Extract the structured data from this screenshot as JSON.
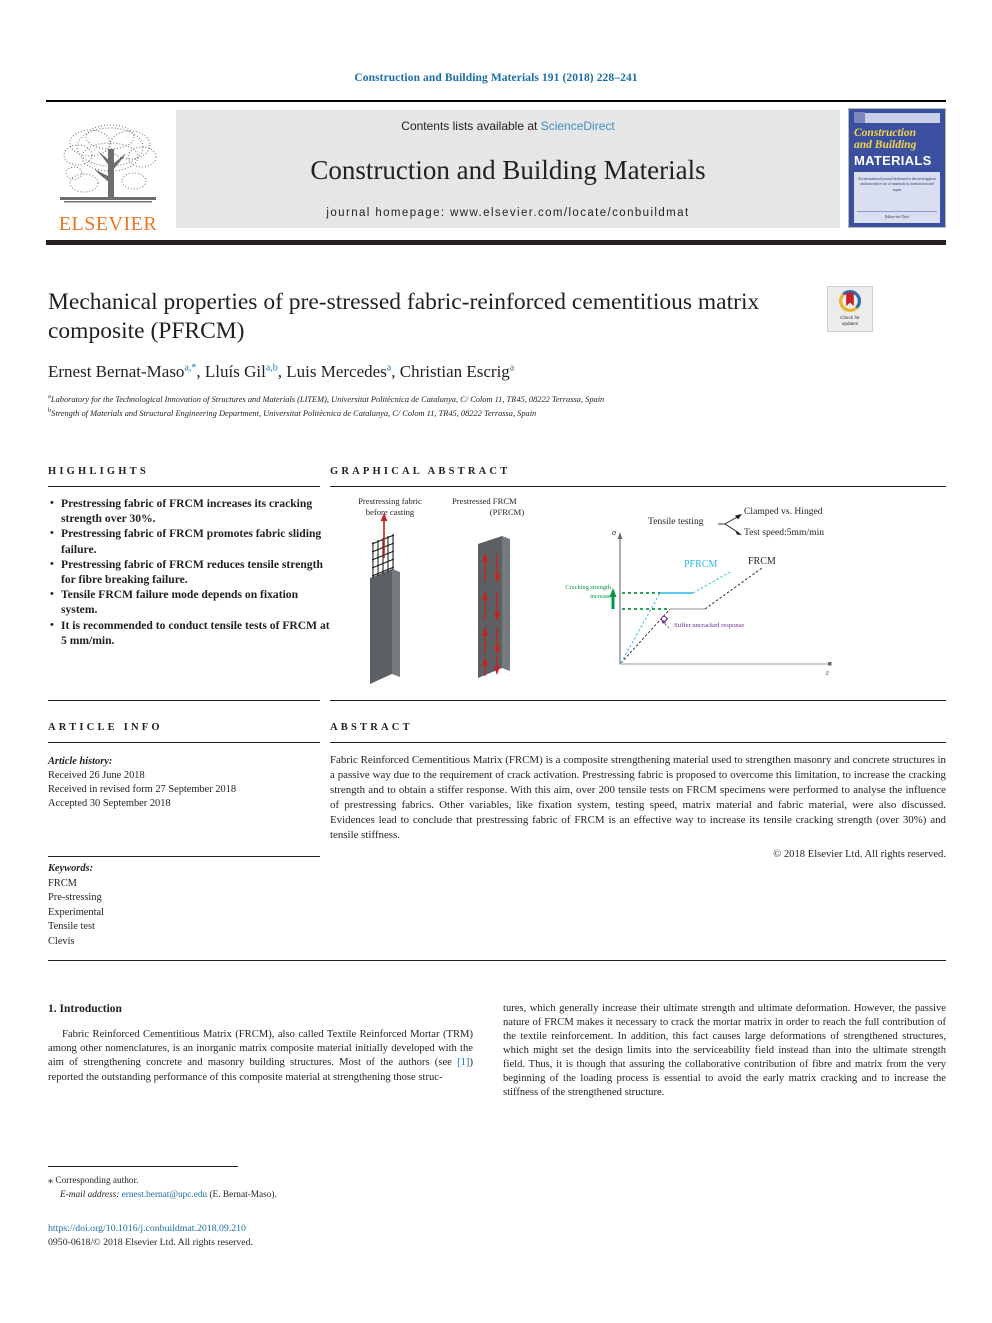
{
  "running_head": "Construction and Building Materials 191 (2018) 228–241",
  "masthead": {
    "publisher_name": "ELSEVIER",
    "contents_prefix": "Contents lists available at ",
    "sciencedirect": "ScienceDirect",
    "journal_name": "Construction and Building Materials",
    "homepage": "journal homepage: www.elsevier.com/locate/conbuildmat",
    "cover": {
      "line1": "Construction",
      "line2": "and Building",
      "line3": "MATERIALS",
      "blurb": "An international journal dedicated to the investigation and innovative use of materials in construction and repair",
      "foot": "Editor-in-Chief"
    }
  },
  "article": {
    "title": "Mechanical properties of pre-stressed fabric-reinforced cementitious matrix composite (PFRCM)",
    "authors_html": "Ernest Bernat-Maso, Lluís Gil, Luis Mercedes, Christian Escrig",
    "authors": [
      {
        "name": "Ernest Bernat-Maso",
        "sup": "a,*"
      },
      {
        "name": "Lluís Gil",
        "sup": "a,b"
      },
      {
        "name": "Luis Mercedes",
        "sup": "a"
      },
      {
        "name": "Christian Escrig",
        "sup": "a"
      }
    ],
    "affiliations": [
      {
        "marker": "a",
        "text": "Laboratory for the Technological Innovation of Structures and Materials (LITEM), Universitat Politècnica de Catalunya, C/ Colom 11, TR45, 08222 Terrassa, Spain"
      },
      {
        "marker": "b",
        "text": "Strength of Materials and Structural Engineering Department, Universitat Politècnica de Catalunya, C/ Colom 11, TR45, 08222 Terrassa, Spain"
      }
    ],
    "crossmark": {
      "line1": "Check for",
      "line2": "updates"
    }
  },
  "highlights": {
    "heading": "HIGHLIGHTS",
    "items": [
      "Prestressing fabric of FRCM increases its cracking strength over 30%.",
      "Prestressing fabric of FRCM promotes fabric sliding failure.",
      "Prestressing fabric of FRCM reduces tensile strength for fibre breaking failure.",
      "Tensile FRCM failure mode depends on fixation system.",
      "It is recommended to conduct tensile tests of FRCM at 5 mm/min."
    ]
  },
  "graphical_abstract": {
    "heading": "GRAPHICAL ABSTRACT",
    "labels": {
      "panel1_l1": "Prestressing fabric",
      "panel1_l2": "before casting",
      "panel2_l1": "Prestressed FRCM",
      "panel2_l2": "(PFRCM)",
      "tensile_testing": "Tensile testing",
      "clamped_hinged": "Clamped vs. Hinged",
      "test_speed": "Test speed:5mm/min",
      "pfrcm": "PFRCM",
      "frcm": "FRCM",
      "cracking_l1": "Cracking strength",
      "cracking_l2": "increase",
      "stiffer": "Stiffer uncracked response",
      "y_axis": "σ",
      "x_axis": "ε"
    },
    "colors": {
      "pfrcm": "#29b6e8",
      "frcm": "#231f20",
      "cracking": "#0a9648",
      "stiffer": "#6a2f8f",
      "arrow_red": "#cc1f1f",
      "specimen": "#5a5e60"
    }
  },
  "article_info": {
    "heading": "ARTICLE INFO",
    "history_label": "Article history:",
    "history": [
      "Received 26 June 2018",
      "Received in revised form 27 September 2018",
      "Accepted 30 September 2018"
    ],
    "keywords_label": "Keywords:",
    "keywords": [
      "FRCM",
      "Pre-stressing",
      "Experimental",
      "Tensile test",
      "Clevis"
    ]
  },
  "abstract": {
    "heading": "ABSTRACT",
    "text": "Fabric Reinforced Cementitious Matrix (FRCM) is a composite strengthening material used to strengthen masonry and concrete structures in a passive way due to the requirement of crack activation. Prestressing fabric is proposed to overcome this limitation, to increase the cracking strength and to obtain a stiffer response. With this aim, over 200 tensile tests on FRCM specimens were performed to analyse the influence of prestressing fabrics. Other variables, like fixation system, testing speed, matrix material and fabric material, were also discussed. Evidences lead to conclude that prestressing fabric of FRCM is an effective way to increase its tensile cracking strength (over 30%) and tensile stiffness.",
    "copyright": "© 2018 Elsevier Ltd. All rights reserved."
  },
  "body": {
    "section_title": "1. Introduction",
    "left_paragraph_part1": "Fabric Reinforced Cementitious Matrix (FRCM), also called Textile Reinforced Mortar (TRM) among other nomenclatures, is an inorganic matrix composite material initially developed with the aim of strengthening concrete and masonry building structures. Most of the authors (see ",
    "reference_link": "[1]",
    "left_paragraph_part2": ") reported the outstanding performance of this composite material at strengthening those struc-",
    "right_paragraph": "tures, which generally increase their ultimate strength and ultimate deformation. However, the passive nature of FRCM makes it necessary to crack the mortar matrix in order to reach the full contribution of the textile reinforcement. In addition, this fact causes large deformations of strengthened structures, which might set the design limits into the serviceability field instead than into the ultimate strength field. Thus, it is though that assuring the collaborative contribution of fibre and matrix from the very beginning of the loading process is essential to avoid the early matrix cracking and to increase the stiffness of the strengthened structure."
  },
  "footer": {
    "corresponding_star": "⁎",
    "corresponding_label": "Corresponding author.",
    "email_label": "E-mail address:",
    "email": "ernest.bernat@upc.edu",
    "email_owner": "(E. Bernat-Maso).",
    "doi": "https://doi.org/10.1016/j.conbuildmat.2018.09.210",
    "issn": "0950-0618/© 2018 Elsevier Ltd. All rights reserved."
  },
  "colors": {
    "link": "#1a6ea8",
    "sciencedirect": "#3c8fc4",
    "elsevier_orange": "#E87722",
    "sup": "#2a7ab0"
  }
}
